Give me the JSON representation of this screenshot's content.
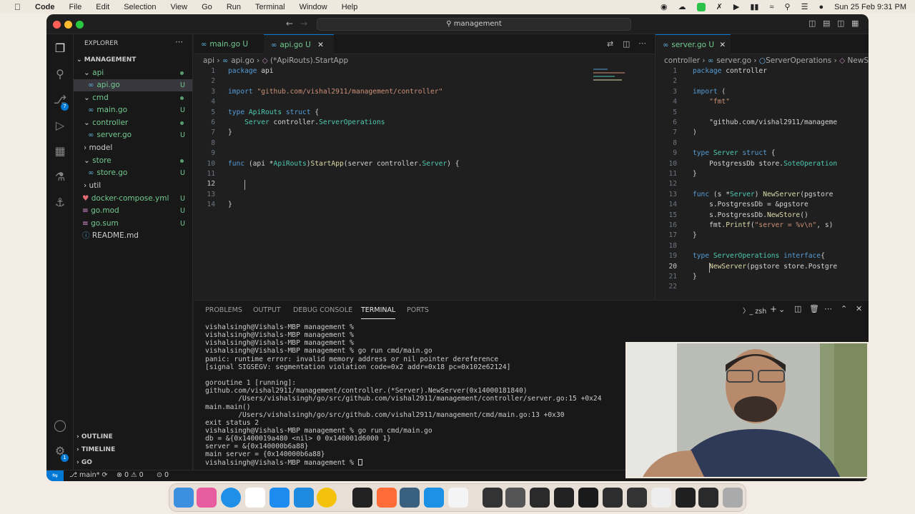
{
  "menubar": {
    "app": "Code",
    "items": [
      "File",
      "Edit",
      "Selection",
      "View",
      "Go",
      "Run",
      "Terminal",
      "Window",
      "Help"
    ],
    "datetime": "Sun 25 Feb  9:31 PM"
  },
  "window": {
    "search": "management"
  },
  "explorer": {
    "title": "EXPLORER",
    "root": "MANAGEMENT",
    "rows": [
      {
        "label": "api",
        "status": ""
      },
      {
        "label": "api.go",
        "status": "U"
      },
      {
        "label": "cmd",
        "status": ""
      },
      {
        "label": "main.go",
        "status": "U"
      },
      {
        "label": "controller",
        "status": ""
      },
      {
        "label": "server.go",
        "status": "U"
      },
      {
        "label": "model",
        "status": ""
      },
      {
        "label": "store",
        "status": ""
      },
      {
        "label": "store.go",
        "status": "U"
      },
      {
        "label": "util",
        "status": ""
      },
      {
        "label": "docker-compose.yml",
        "status": "U"
      },
      {
        "label": "go.mod",
        "status": "U"
      },
      {
        "label": "go.sum",
        "status": "U"
      },
      {
        "label": "README.md",
        "status": ""
      }
    ],
    "outline": "OUTLINE",
    "timeline": "TIMELINE",
    "go": "GO",
    "scm_badge": "7",
    "settings_badge": "1"
  },
  "editor1": {
    "tabs": [
      {
        "label": "main.go",
        "status": "U"
      },
      {
        "label": "api.go",
        "status": "U"
      }
    ],
    "breadcrumb": [
      "api",
      "api.go",
      "(*ApiRouts).StartApp"
    ],
    "line_numbers": [
      "1",
      "2",
      "3",
      "4",
      "5",
      "6",
      "7",
      "8",
      "9",
      "10",
      "11",
      "12",
      "13",
      "14"
    ],
    "lines": [
      "package api",
      "",
      "import \"github.com/vishal2911/management/controller\"",
      "",
      "type ApiRouts struct {",
      "    Server controller.ServerOperations",
      "}",
      "",
      "",
      "func (api *ApiRouts)StartApp(server controller.Server) {",
      "",
      "    ",
      "",
      "}"
    ]
  },
  "editor2": {
    "tab": {
      "label": "server.go",
      "status": "U"
    },
    "breadcrumb": [
      "controller",
      "server.go",
      "ServerOperations",
      "NewS"
    ],
    "line_numbers": [
      "1",
      "2",
      "3",
      "4",
      "5",
      "6",
      "7",
      "8",
      "9",
      "10",
      "11",
      "12",
      "13",
      "14",
      "15",
      "16",
      "17",
      "18",
      "19",
      "20",
      "21",
      "22"
    ],
    "lines": [
      "package controller",
      "",
      "import (",
      "    \"fmt\"",
      "",
      "    \"github.com/vishal2911/manageme",
      ")",
      "",
      "type Server struct {",
      "    PostgressDb store.SoteOperation",
      "}",
      "",
      "func (s *Server) NewServer(pgstore",
      "    s.PostgressDb = &pgstore",
      "    s.PostgressDb.NewStore()",
      "    fmt.Printf(\"server = %v\\n\", s)",
      "}",
      "",
      "type ServerOperations interface{",
      "    NewServer(pgstore store.Postgre",
      "}",
      ""
    ]
  },
  "panel": {
    "tabs": [
      "PROBLEMS",
      "OUTPUT",
      "DEBUG CONSOLE",
      "TERMINAL",
      "PORTS"
    ],
    "shell": "zsh",
    "terminal_lines": [
      "vishalsingh@Vishals-MBP management %",
      "vishalsingh@Vishals-MBP management %",
      "vishalsingh@Vishals-MBP management %",
      "vishalsingh@Vishals-MBP management % go run cmd/main.go",
      "panic: runtime error: invalid memory address or nil pointer dereference",
      "[signal SIGSEGV: segmentation violation code=0x2 addr=0x18 pc=0x102e62124]",
      "",
      "goroutine 1 [running]:",
      "github.com/vishal2911/management/controller.(*Server).NewServer(0x14000181840)",
      "        /Users/vishalsingh/go/src/github.com/vishal2911/management/controller/server.go:15 +0x24",
      "main.main()",
      "        /Users/vishalsingh/go/src/github.com/vishal2911/management/cmd/main.go:13 +0x30",
      "exit status 2",
      "vishalsingh@Vishals-MBP management % go run cmd/main.go",
      "db = &{0x1400019a480 <nil> 0 0x140001d6000 1}",
      "server = &{0x140000b6a88}",
      "main server = {0x140000b6a88}",
      "vishalsingh@Vishals-MBP management % "
    ]
  },
  "status": {
    "branch": "main*",
    "problems": "⊗ 0 ⚠ 0",
    "ports": "0"
  },
  "colors": {
    "accent": "#0078d4",
    "editor_bg": "#1f1f1f",
    "sidebar_bg": "#181818"
  }
}
